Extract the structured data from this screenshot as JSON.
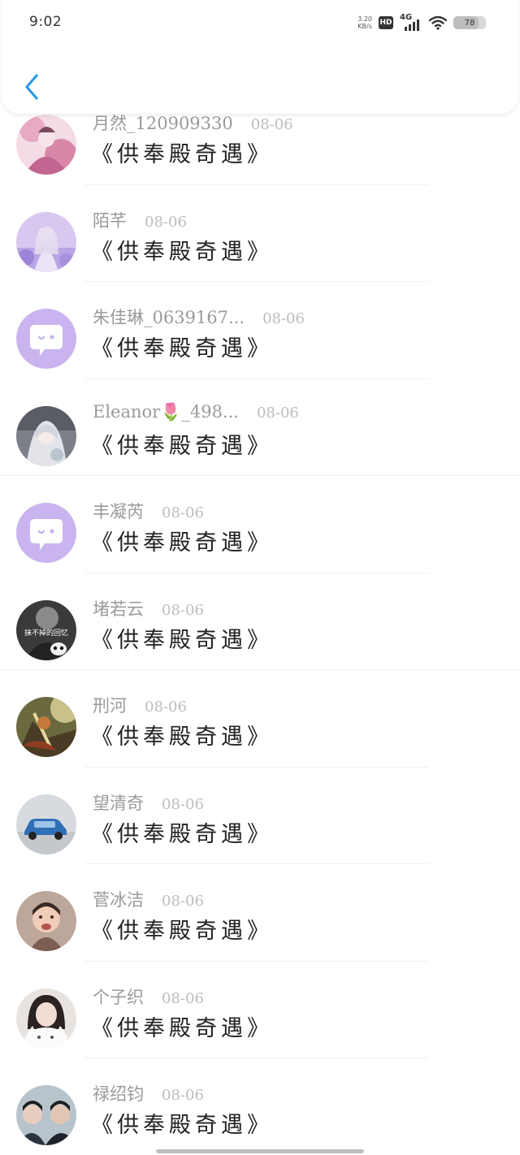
{
  "status_bar": {
    "time": "9:02",
    "net_speed_value": "3.20",
    "net_speed_unit": "KB/s",
    "hd_label": "HD",
    "cell_label": "4G",
    "battery_level": "78",
    "battery_fraction": 0.78
  },
  "nav": {
    "back_icon": "chevron-left-icon",
    "accent_color": "#2a9bea"
  },
  "items": [
    {
      "name": "月然_120909330",
      "date": "08-06",
      "message": "《供奉殿奇遇》",
      "avatar": "anime-pink-art"
    },
    {
      "name": "陌芊",
      "date": "08-06",
      "message": "《供奉殿奇遇》",
      "avatar": "anime-purple-girl"
    },
    {
      "name": "朱佳琳_0639167...",
      "date": "08-06",
      "message": "《供奉殿奇遇》",
      "avatar": "default-chat-bubble"
    },
    {
      "name": "Eleanor🌷_498...",
      "date": "08-06",
      "message": "《供奉殿奇遇》",
      "avatar": "anime-white-hair"
    },
    {
      "name": "丰凝芮",
      "date": "08-06",
      "message": "《供奉殿奇遇》",
      "avatar": "default-chat-bubble"
    },
    {
      "name": "堵若云",
      "date": "08-06",
      "message": "《供奉殿奇遇》",
      "avatar": "black-white-photo"
    },
    {
      "name": "刑河",
      "date": "08-06",
      "message": "《供奉殿奇遇》",
      "avatar": "game-warrior-art"
    },
    {
      "name": "望清奇",
      "date": "08-06",
      "message": "《供奉殿奇遇》",
      "avatar": "blue-car-photo"
    },
    {
      "name": "菅冰洁",
      "date": "08-06",
      "message": "《供奉殿奇遇》",
      "avatar": "crying-child-photo"
    },
    {
      "name": "个子织",
      "date": "08-06",
      "message": "《供奉殿奇遇》",
      "avatar": "girl-with-cat-photo"
    },
    {
      "name": "禄绍钧",
      "date": "08-06",
      "message": "《供奉殿奇遇》",
      "avatar": "two-men-photo"
    }
  ],
  "avatar_text": {
    "black-white-photo": "抹不掉的回忆"
  }
}
